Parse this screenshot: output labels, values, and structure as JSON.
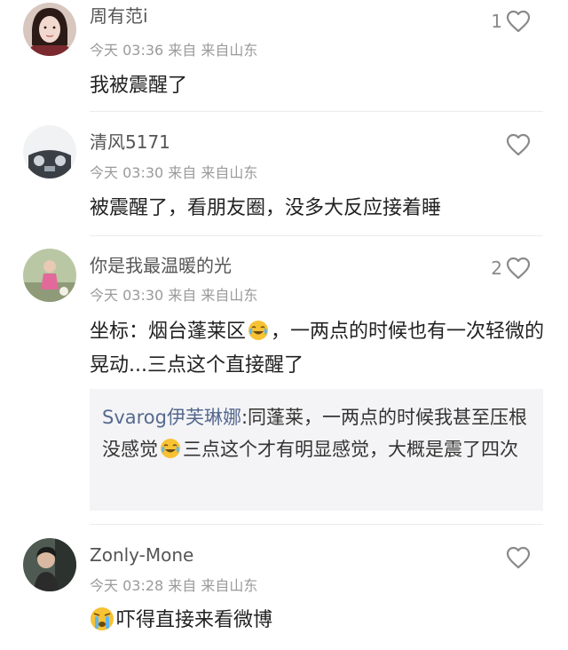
{
  "comments": [
    {
      "username": "周有范i",
      "meta": "今天 03:36 来自 来自山东",
      "text": "我被震醒了",
      "likes": "1",
      "avatar_icon": "woman-portrait-avatar"
    },
    {
      "username": "清风5171",
      "meta": "今天 03:30 来自 来自山东",
      "text": "被震醒了，看朋友圈，没多大反应接着睡",
      "likes": "",
      "avatar_icon": "car-dashboard-avatar"
    },
    {
      "username": "你是我最温暖的光",
      "meta": "今天 03:30 来自 来自山东",
      "text_part1": "坐标：烟台蓬莱区",
      "text_part2": "，一两点的时候也有一次轻微的晃动...三点这个直接醒了",
      "likes": "2",
      "avatar_icon": "child-outdoor-avatar",
      "reply": {
        "user": "Svarog伊芙琳娜",
        "text_part1": ":同蓬莱，一两点的时候我甚至压根没感觉",
        "text_part2": "三点这个才有明显感觉，大概是震了四次"
      }
    },
    {
      "username": "Zonly-Mone",
      "meta": "今天 03:28 来自 来自山东",
      "text": "吓得直接来看微博",
      "likes": "",
      "avatar_icon": "person-car-avatar"
    }
  ],
  "colors": {
    "name": "#555555",
    "meta": "#9a9a9a",
    "reply_user": "#55698f",
    "reply_bg": "#f4f4f6"
  },
  "icons": [
    "heart-icon",
    "laugh-cry-emoji",
    "scared-cry-emoji"
  ]
}
